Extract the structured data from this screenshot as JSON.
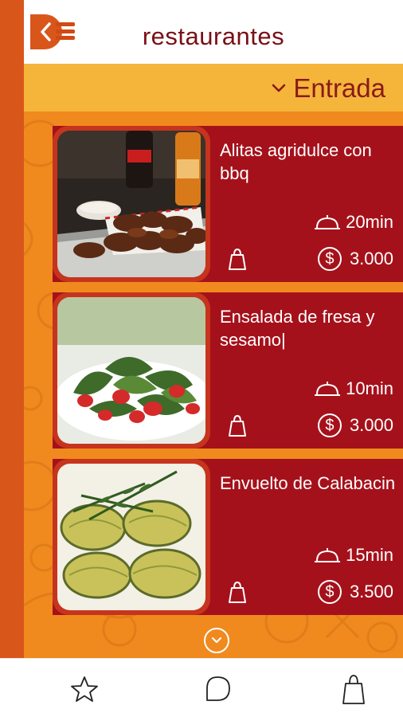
{
  "header": {
    "title": "restaurantes",
    "back_icon": "chevron-left-icon",
    "menu_icon": "hamburger-menu-icon"
  },
  "category": {
    "label": "Entrada",
    "icon": "chevron-down-icon"
  },
  "items": [
    {
      "title": "Alitas agridulce con bbq",
      "time": "20min",
      "price": "3.000",
      "photo": "wings-photo"
    },
    {
      "title": "Ensalada de fresa y sesamo|",
      "time": "10min",
      "price": "3.000",
      "photo": "strawberry-salad-photo"
    },
    {
      "title": "Envuelto de Calabacin",
      "time": "15min",
      "price": "3.500",
      "photo": "zucchini-rolls-photo"
    }
  ],
  "tabbar": {
    "tabs": [
      {
        "icon": "star-icon"
      },
      {
        "icon": "chat-bubble-icon"
      },
      {
        "icon": "shopping-bag-icon"
      }
    ]
  },
  "colors": {
    "brand_orange": "#d9561b",
    "title_red": "#7a0f16",
    "category_yellow": "#f4b53a",
    "card_red": "#a5111b",
    "background_orange": "#f08a1e"
  }
}
